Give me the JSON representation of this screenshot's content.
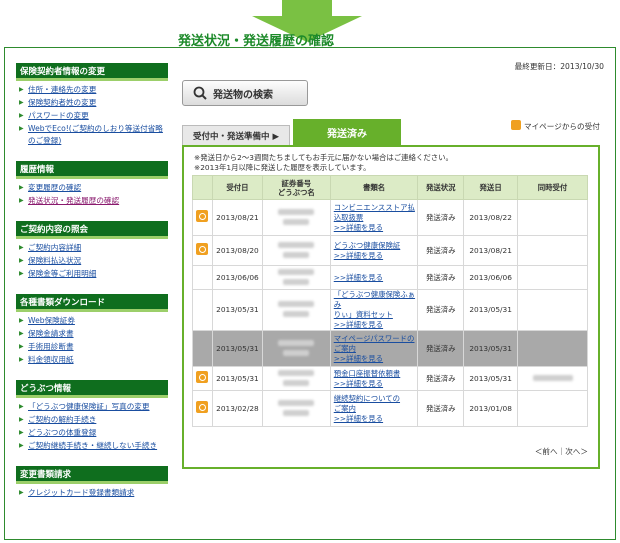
{
  "header": {
    "updated": "最終更新日：2013/10/30",
    "title": "発送状況・発送履歴の確認"
  },
  "colors": {
    "brand_green": "#0f6e1e",
    "accent_green": "#67b02b",
    "link_blue": "#1a4ea0"
  },
  "sidebar": [
    {
      "title": "保険契約者情報の変更",
      "items": [
        "住所・連絡先の変更",
        "保険契約者姓の変更",
        "パスワードの変更",
        "WebでEco!(ご契約のしおり等送付省略のご登録)"
      ]
    },
    {
      "title": "履歴情報",
      "items": [
        "変更履歴の確認",
        "発送状況・発送履歴の確認"
      ]
    },
    {
      "title": "ご契約内容の照会",
      "items": [
        "ご契約内容詳細",
        "保険料払込状況",
        "保険金等ご利用明細"
      ]
    },
    {
      "title": "各種書類ダウンロード",
      "items": [
        "Web保険証券",
        "保険金請求書",
        "手術用診断書",
        "料金領収用紙"
      ]
    },
    {
      "title": "どうぶつ情報",
      "items": [
        "「どうぶつ健康保険証」写真の変更",
        "ご契約の解約手続き",
        "どうぶつの体重登録",
        "ご契約継続手続き・継続しない手続き"
      ]
    },
    {
      "title": "変更書類請求",
      "items": [
        "クレジットカード登録書類請求"
      ]
    }
  ],
  "search_button": "発送物の検索",
  "tabs": {
    "pending": "受付中・発送準備中 ▶",
    "sent": "発送済み"
  },
  "mypage_legend": "マイページからの受付",
  "notes": [
    "※発送日から2〜3週間たちましてもお手元に届かない場合はご連絡ください。",
    "※2013年1月以降に発送した履歴を表示しています。"
  ],
  "table": {
    "headers": [
      "",
      "受付日",
      "証券番号\nどうぶつ名",
      "書類名",
      "発送状況",
      "発送日",
      "同時受付"
    ],
    "rows": [
      {
        "icon": true,
        "date": "2013/08/21",
        "doc": [
          "コンビニエンスストア払",
          "込取扱票",
          ">>詳細を見る"
        ],
        "status": "発送済み",
        "sent": "2013/08/22",
        "sim": false,
        "gray": false
      },
      {
        "icon": true,
        "date": "2013/08/20",
        "doc": [
          "どうぶつ健康保険証",
          ">>詳細を見る"
        ],
        "status": "発送済み",
        "sent": "2013/08/21",
        "sim": false,
        "gray": false
      },
      {
        "icon": false,
        "date": "2013/06/06",
        "doc": [
          ">>詳細を見る"
        ],
        "status": "発送済み",
        "sent": "2013/06/06",
        "sim": false,
        "gray": false
      },
      {
        "icon": false,
        "date": "2013/05/31",
        "doc": [
          "「どうぶつ健康保険ふぁみ",
          "りぃ」資料セット",
          ">>詳細を見る"
        ],
        "status": "発送済み",
        "sent": "2013/05/31",
        "sim": false,
        "gray": false
      },
      {
        "icon": false,
        "date": "2013/05/31",
        "doc": [
          "マイページパスワードの",
          "ご案内",
          ">>詳細を見る"
        ],
        "status": "発送済み",
        "sent": "2013/05/31",
        "sim": false,
        "gray": true
      },
      {
        "icon": true,
        "date": "2013/05/31",
        "doc": [
          "預金口座振替依頼書",
          ">>詳細を見る"
        ],
        "status": "発送済み",
        "sent": "2013/05/31",
        "sim": true,
        "gray": false
      },
      {
        "icon": true,
        "date": "2013/02/28",
        "doc": [
          "継続契約についての",
          "ご案内",
          ">>詳細を見る"
        ],
        "status": "発送済み",
        "sent": "2013/01/08",
        "sim": false,
        "gray": false
      }
    ]
  },
  "pager": "＜前へ｜次へ＞"
}
